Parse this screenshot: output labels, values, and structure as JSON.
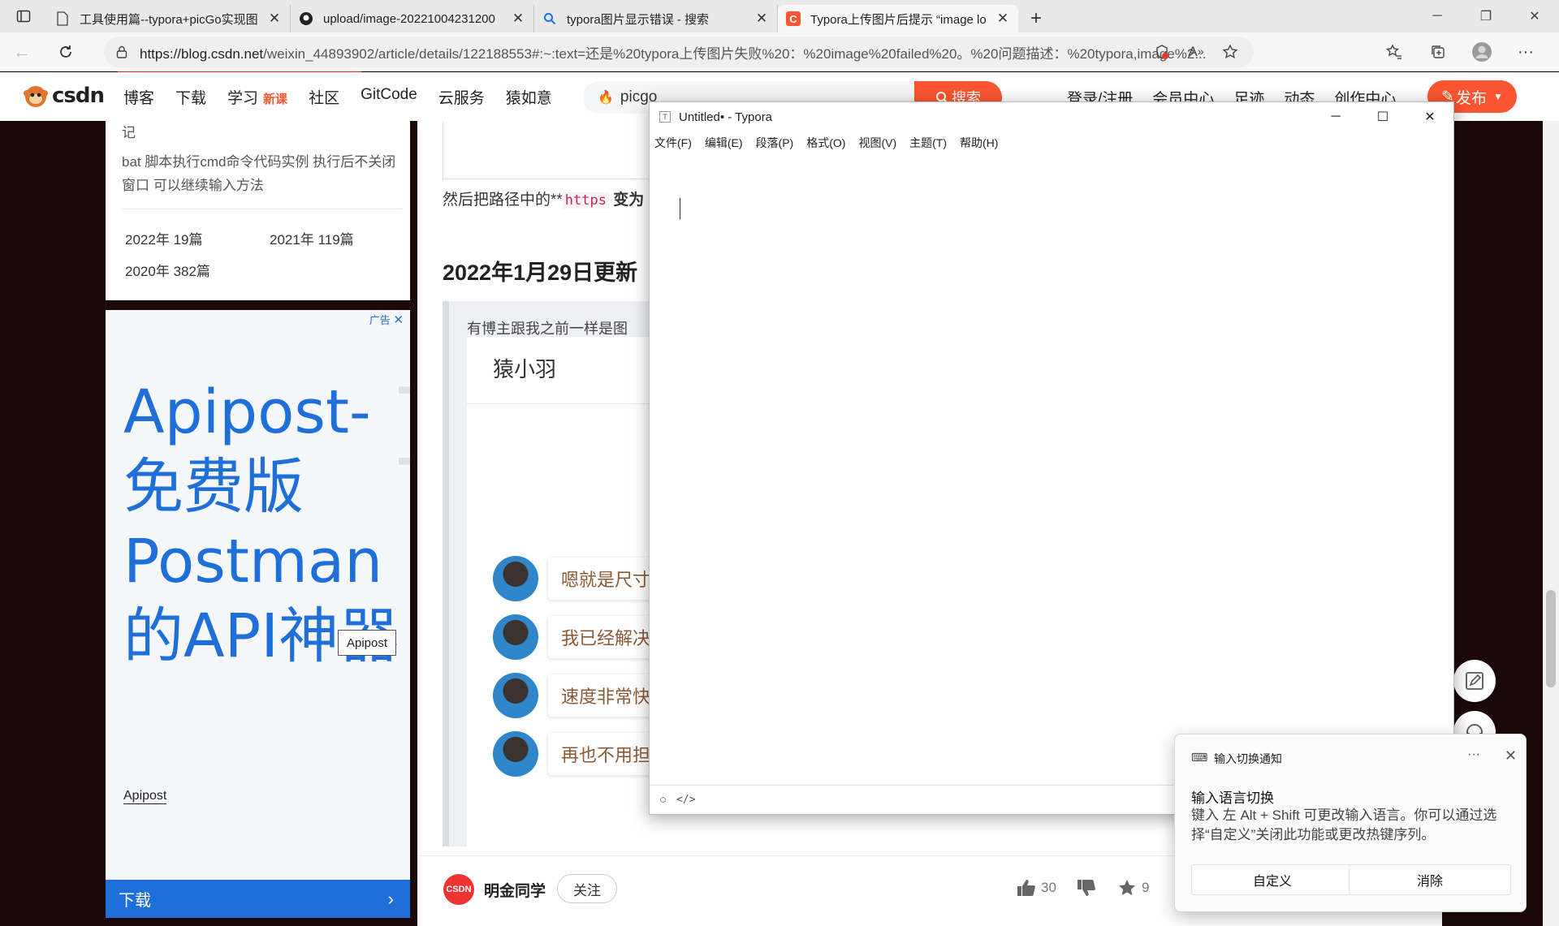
{
  "browser": {
    "tabs": [
      {
        "title": "工具使用篇--typora+picGo实现图",
        "icon": "document-icon"
      },
      {
        "title": "upload/image-20221004231200",
        "icon": "github-icon"
      },
      {
        "title": "typora图片显示错误 - 搜索",
        "icon": "search-icon"
      },
      {
        "title": "Typora上传图片后提示 “image lo",
        "icon": "csdn-icon",
        "active": true
      }
    ],
    "url_host": "https://blog.csdn.net",
    "url_rest": "/weixin_44893902/article/details/122188553#:~:text=还是%20typora上传图片失败%20：%20image%20failed%20。%20问题描述：%20typora,image%2..."
  },
  "csdn": {
    "logo": "CSDN",
    "nav": [
      "博客",
      "下载",
      "学习",
      "社区",
      "GitCode",
      "云服务",
      "猿如意"
    ],
    "nav_new_badge": "新课",
    "search_text": "picgo",
    "search_button": "搜索",
    "right_links": [
      "登录/注册",
      "会员中心",
      "足迹",
      "动态",
      "创作中心"
    ],
    "publish": "发布"
  },
  "sidebar": {
    "fragment": "记",
    "related": "bat 脚本执行cmd命令代码实例 执行后不关闭窗口 可以继续输入方法",
    "archives": [
      {
        "year": "2022年",
        "count": "19篇"
      },
      {
        "year": "2021年",
        "count": "119篇"
      },
      {
        "year": "2020年",
        "count": "382篇"
      }
    ],
    "ad": {
      "label": "广告",
      "title": "Apipost-免费版Postman的API神器",
      "watermark": "Apipost",
      "brand_box": "Apipost",
      "brand_link": "Apipost",
      "download": "下载"
    }
  },
  "article": {
    "para_prefix": "然后把路径中的**",
    "para_code": "https",
    "para_suffix": "变为",
    "heading": "2022年1月29日更新",
    "quote_text": "有博主跟我之前一样是图",
    "chat_name": "猿小羽",
    "messages": [
      "嗯就是尺寸",
      "我已经解决",
      "速度非常快",
      "再也不用担"
    ],
    "author": "明金同学",
    "follow": "关注",
    "author_logo": "CSDN",
    "likes": "30",
    "favorites": "9"
  },
  "typora": {
    "title": "Untitled• - Typora",
    "app_icon": "T",
    "menus": [
      "文件(F)",
      "编辑(E)",
      "段落(P)",
      "格式(O)",
      "视图(V)",
      "主题(T)",
      "帮助(H)"
    ]
  },
  "toast": {
    "header": "输入切换通知",
    "title": "输入语言切换",
    "body": "键入 左 Alt + Shift 可更改输入语言。你可以通过选择“自定义”关闭此功能或更改热键序列。",
    "btn_customize": "自定义",
    "btn_dismiss": "消除",
    "more": "···"
  }
}
